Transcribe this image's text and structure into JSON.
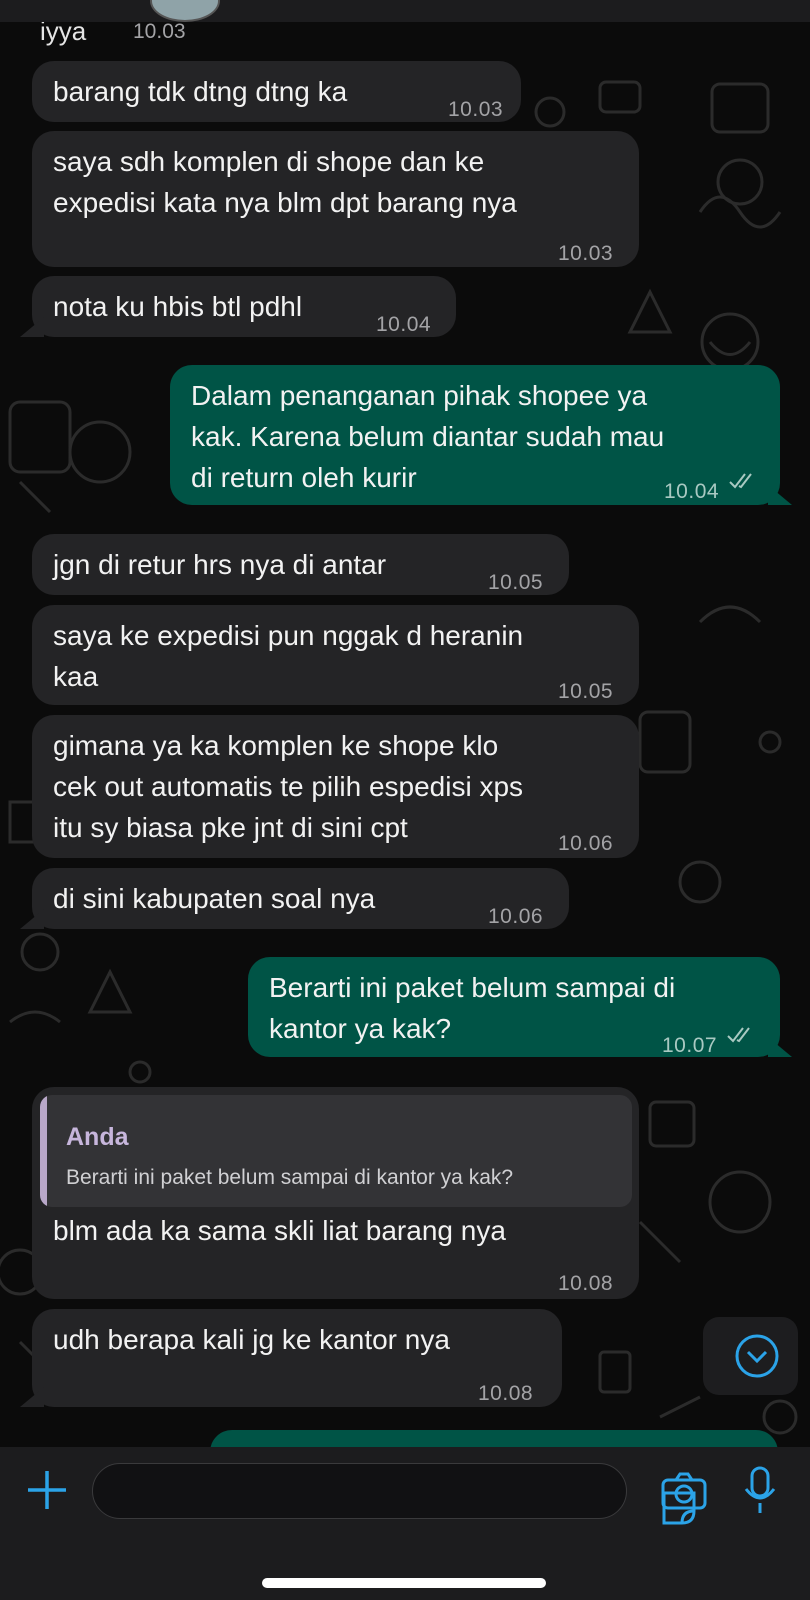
{
  "header": {
    "partial_sender_label": "iyya",
    "partial_time": "10.03"
  },
  "messages": [
    {
      "direction": "in",
      "text": "barang tdk dtng dtng ka",
      "time": "10.03"
    },
    {
      "direction": "in",
      "text": "saya sdh komplen di shope dan ke\nexpedisi kata nya blm dpt barang nya",
      "time": "10.03"
    },
    {
      "direction": "in",
      "text": "nota ku hbis btl pdhl",
      "time": "10.04"
    },
    {
      "direction": "out",
      "text": "Dalam penanganan pihak shopee ya\nkak. Karena belum diantar sudah mau\ndi return oleh kurir",
      "time": "10.04",
      "status": "read"
    },
    {
      "direction": "in",
      "text": "jgn di retur hrs nya di antar",
      "time": "10.05"
    },
    {
      "direction": "in",
      "text": "saya ke expedisi pun nggak d heranin\nkaa",
      "time": "10.05"
    },
    {
      "direction": "in",
      "text": "gimana ya ka komplen ke shope klo\ncek out automatis te pilih espedisi xps\nitu sy biasa pke jnt di sini cpt",
      "time": "10.06"
    },
    {
      "direction": "in",
      "text": "di sini kabupaten soal nya",
      "time": "10.06"
    },
    {
      "direction": "out",
      "text": "Berarti ini paket belum sampai di\nkantor ya kak?",
      "time": "10.07",
      "status": "read"
    },
    {
      "direction": "in",
      "text": "blm ada ka sama skli liat barang nya",
      "time": "10.08",
      "quote": {
        "author": "Anda",
        "text": "Berarti ini paket belum sampai di kantor ya kak?"
      }
    },
    {
      "direction": "in",
      "text": "udh berapa kali jg ke kantor nya",
      "time": "10.08"
    }
  ],
  "icons": {
    "scroll_down": "chevron-down-circle-icon",
    "attach": "plus-icon",
    "sticker": "sticker-icon",
    "camera": "camera-icon",
    "microphone": "microphone-icon"
  },
  "colors": {
    "accent": "#2ba3e8",
    "incoming_bubble": "#242426",
    "outgoing_bubble": "#005446",
    "background": "#0b0b0b"
  }
}
